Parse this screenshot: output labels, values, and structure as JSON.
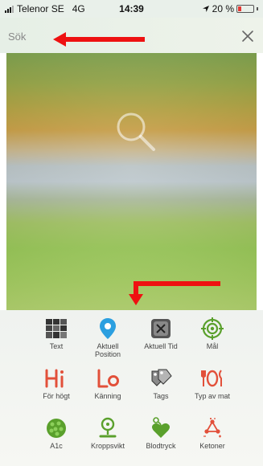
{
  "status_bar": {
    "carrier": "Telenor SE",
    "network": "4G",
    "time": "14:39",
    "battery": "20 %",
    "battery_level": 0.2
  },
  "search": {
    "placeholder": "Sök",
    "close_icon": "close-icon"
  },
  "hero": {
    "icon": "magnifier-icon"
  },
  "items": [
    {
      "label": "Text",
      "icon": "tiles-icon"
    },
    {
      "label": "Aktuell Position",
      "icon": "location-pin-icon"
    },
    {
      "label": "Aktuell Tid",
      "icon": "clock-tile-icon"
    },
    {
      "label": "Mål",
      "icon": "target-icon"
    },
    {
      "label": "För högt",
      "icon": "hi-icon"
    },
    {
      "label": "Känning",
      "icon": "lo-icon"
    },
    {
      "label": "Tags",
      "icon": "tags-icon"
    },
    {
      "label": "Typ av mat",
      "icon": "fork-knife-icon"
    },
    {
      "label": "A1c",
      "icon": "a1c-icon"
    },
    {
      "label": "Kroppsvikt",
      "icon": "scale-icon"
    },
    {
      "label": "Blodtryck",
      "icon": "blood-pressure-icon"
    },
    {
      "label": "Ketoner",
      "icon": "ketones-icon"
    }
  ],
  "colors": {
    "accent_green": "#5aa02c",
    "hi_lo_red": "#e2503a",
    "pin_blue": "#2b9fe0",
    "annotation_red": "#e11111"
  }
}
